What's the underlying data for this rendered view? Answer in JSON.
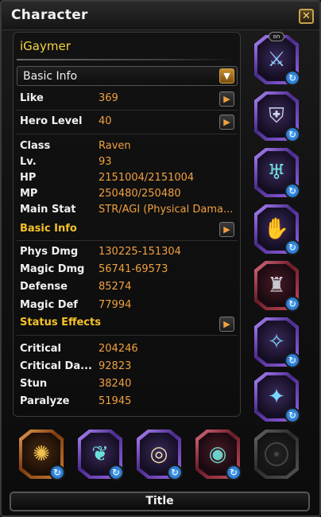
{
  "window": {
    "title": "Character"
  },
  "character": {
    "name": "iGaymer"
  },
  "dropdown": {
    "selected": "Basic Info"
  },
  "basic": [
    {
      "label": "Like",
      "value": "369"
    },
    {
      "label": "Hero Level",
      "value": "40"
    }
  ],
  "info": [
    {
      "label": "Class",
      "value": "Raven"
    },
    {
      "label": "Lv.",
      "value": "93"
    },
    {
      "label": "HP",
      "value": "2151004/2151004"
    },
    {
      "label": "MP",
      "value": "250480/250480"
    },
    {
      "label": "Main Stat",
      "value": "STR/AGI (Physical Dama..."
    }
  ],
  "sections": {
    "basic_info": "Basic Info",
    "status_effects": "Status Effects"
  },
  "combat": [
    {
      "label": "Phys Dmg",
      "value": "130225-151304"
    },
    {
      "label": "Magic Dmg",
      "value": "56741-69573"
    },
    {
      "label": "Defense",
      "value": "85274"
    },
    {
      "label": "Magic Def",
      "value": "77994"
    }
  ],
  "status": [
    {
      "label": "Critical",
      "value": "204246"
    },
    {
      "label": "Critical Da...",
      "value": "92823"
    },
    {
      "label": "Stun",
      "value": "38240"
    },
    {
      "label": "Paralyze",
      "value": "51945"
    }
  ],
  "equipment": {
    "right_slots": [
      "weapon-icon",
      "chest-armor-icon",
      "leg-armor-icon",
      "gloves-icon",
      "boots-icon",
      "crest-left-icon",
      "crest-right-icon"
    ],
    "bottom_slots": [
      "necklace-icon",
      "earring-icon",
      "ring-icon",
      "ring-icon",
      "empty-slot-icon"
    ],
    "on_badge": "on"
  },
  "footer": {
    "title_button": "Title"
  },
  "colors": {
    "value": "#f0a040",
    "section": "#f5c228",
    "name": "#f5d442"
  }
}
